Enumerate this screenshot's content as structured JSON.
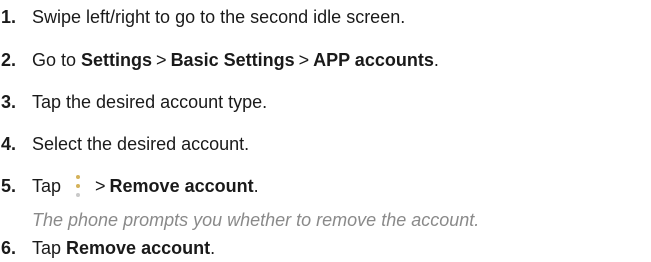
{
  "steps": [
    {
      "num": "1.",
      "text": "Swipe left/right to go to the second idle screen."
    },
    {
      "num": "2.",
      "pre": "Go to ",
      "b1": "Settings",
      "sep1": ">",
      "b2": "Basic Settings",
      "sep2": ">",
      "b3": "APP accounts",
      "post": "."
    },
    {
      "num": "3.",
      "text": "Tap the desired account type."
    },
    {
      "num": "4.",
      "text": "Select the desired account."
    },
    {
      "num": "5.",
      "pre": "Tap",
      "sep": ">",
      "bold": "Remove account",
      "post": "."
    },
    {
      "num": "6.",
      "pre": "Tap ",
      "bold": "Remove account",
      "post": "."
    }
  ],
  "note": "The phone prompts you whether to remove the account.",
  "icons": {
    "more": "more-vertical-icon"
  },
  "colors": {
    "text": "#1a1a1a",
    "note": "#8a8a8a",
    "icon_dot": "#d4b25a"
  }
}
